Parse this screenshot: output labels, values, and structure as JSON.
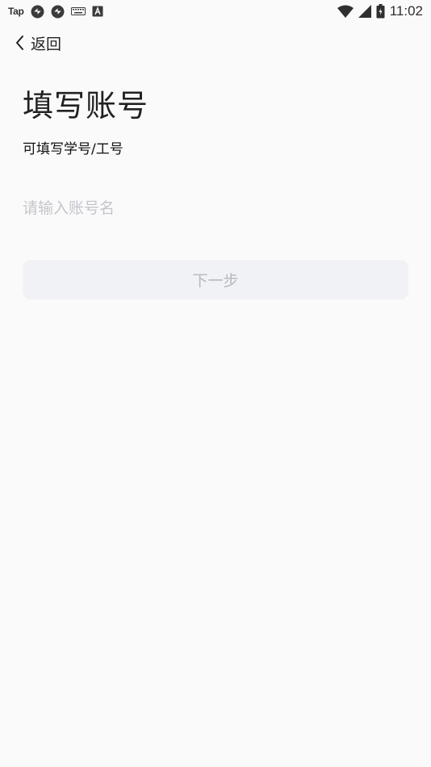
{
  "status_bar": {
    "app_label": "Tap",
    "time": "11:02",
    "icons": [
      "tap-icon",
      "sync-icon",
      "sync-icon",
      "keyboard-icon",
      "font-icon",
      "wifi-icon",
      "signal-icon",
      "battery-icon"
    ]
  },
  "nav": {
    "back_label": "返回"
  },
  "main": {
    "title": "填写账号",
    "subtitle": "可填写学号/工号",
    "input": {
      "placeholder": "请输入账号名",
      "value": ""
    },
    "next_button_label": "下一步"
  },
  "colors": {
    "background": "#fafafa",
    "text_primary": "#222222",
    "placeholder": "#c4c5cb",
    "button_bg": "#f1f2f6",
    "button_text": "#b6b8bf"
  }
}
